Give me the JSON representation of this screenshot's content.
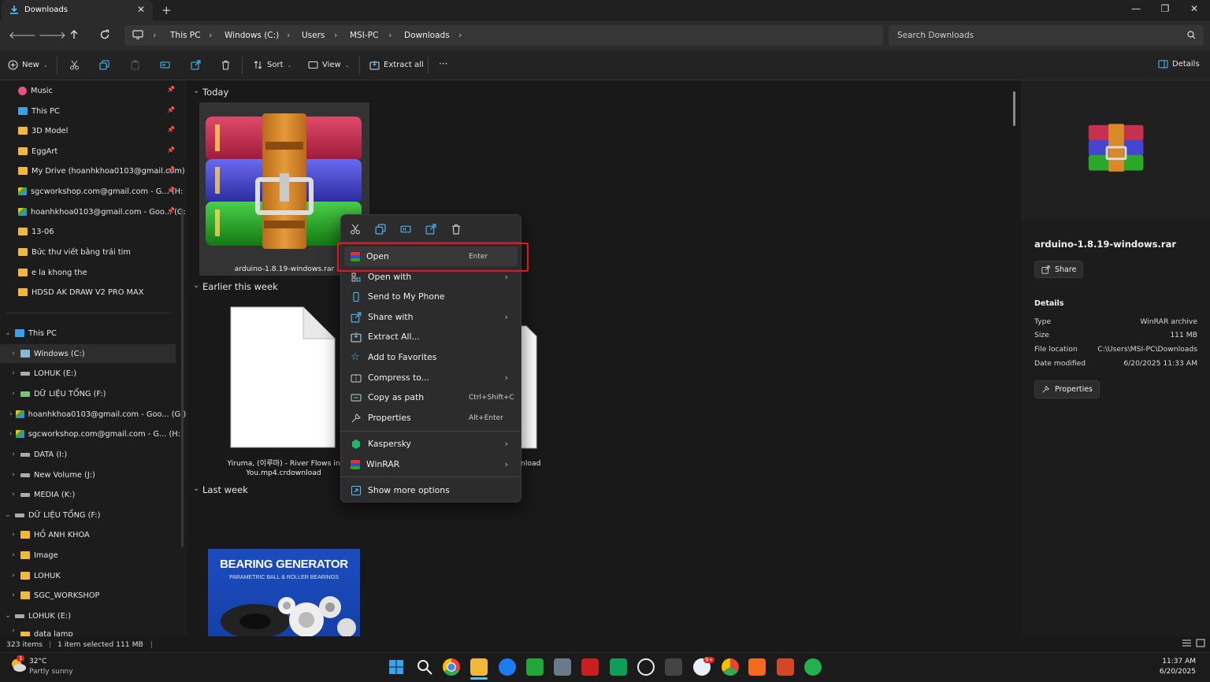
{
  "window": {
    "tab_title": "Downloads",
    "new_tab": "+",
    "close_tab": "✕",
    "minimize": "—",
    "restore": "❐",
    "close": "✕"
  },
  "address": {
    "crumbs": [
      "This PC",
      "Windows (C:)",
      "Users",
      "MSI-PC",
      "Downloads"
    ],
    "search_placeholder": "Search Downloads"
  },
  "commandbar": {
    "new": "New",
    "sort": "Sort",
    "view": "View",
    "extract_all": "Extract all",
    "more": "···",
    "details": "Details"
  },
  "nav": {
    "quick": [
      {
        "label": "Music",
        "icon": "music-icon"
      },
      {
        "label": "This PC",
        "icon": "pc-icon"
      },
      {
        "label": "3D Model",
        "icon": "folder-icon"
      },
      {
        "label": "EggArt",
        "icon": "folder-icon"
      },
      {
        "label": "My Drive (hoanhkhoa0103@gmail.com)",
        "icon": "folder-icon"
      },
      {
        "label": "sgcworkshop.com@gmail.com - G... (H:",
        "icon": "drive-icon"
      },
      {
        "label": "hoanhkhoa0103@gmail.com - Goo... (G:",
        "icon": "drive-icon"
      },
      {
        "label": "13-06",
        "icon": "folder-icon"
      },
      {
        "label": "Bức thư viết bằng trái tim",
        "icon": "folder-icon"
      },
      {
        "label": "e la khong the",
        "icon": "folder-icon"
      },
      {
        "label": "HDSD AK DRAW V2 PRO MAX",
        "icon": "folder-icon"
      }
    ],
    "this_pc": "This PC",
    "drives": [
      {
        "label": "Windows (C:)",
        "icon": "windows-drive-icon"
      },
      {
        "label": "LOHUK (E:)",
        "icon": "drive-icon"
      },
      {
        "label": "DỮ LIỆU TỔNG (F:)",
        "icon": "net-drive-icon"
      },
      {
        "label": "hoanhkhoa0103@gmail.com - Goo... (G:)",
        "icon": "gdrive-icon"
      },
      {
        "label": "sgcworkshop.com@gmail.com - G... (H:)",
        "icon": "gdrive-icon"
      },
      {
        "label": "DATA (I:)",
        "icon": "drive-icon"
      },
      {
        "label": "New Volume (J:)",
        "icon": "drive-icon"
      },
      {
        "label": "MEDIA (K:)",
        "icon": "drive-icon"
      }
    ],
    "f_drive": "DỮ LIỆU TỔNG (F:)",
    "f_children": [
      "HỒ ANH KHOA",
      "Image",
      "LOHUK",
      "SGC_WORKSHOP"
    ],
    "e_drive": "LOHUK (E:)",
    "e_child": "data lamp"
  },
  "content": {
    "groups": {
      "today": "Today",
      "earlier": "Earlier this week",
      "last_week": "Last week"
    },
    "file1": "arduino-1.8.19-windows.rar",
    "file2_line1": "Yiruma, (이루마) - River Flows in",
    "file2_line2": "You.mp4.crdownload",
    "file3_partial": "nload",
    "bearing_title": "BEARING GENERATOR",
    "bearing_sub": "PARAMETRIC BALL & ROLLER BEARINGS"
  },
  "context_menu": {
    "items": [
      {
        "label": "Open",
        "shortcut": "Enter",
        "icon": "winrar-icon",
        "submenu": false
      },
      {
        "label": "Open with",
        "shortcut": "",
        "icon": "open-with-icon",
        "submenu": true
      },
      {
        "label": "Send to My Phone",
        "shortcut": "",
        "icon": "phone-icon",
        "submenu": false
      },
      {
        "label": "Share with",
        "shortcut": "",
        "icon": "share-icon",
        "submenu": true
      },
      {
        "label": "Extract All...",
        "shortcut": "",
        "icon": "extract-icon",
        "submenu": false
      },
      {
        "label": "Add to Favorites",
        "shortcut": "",
        "icon": "star-icon",
        "submenu": false
      },
      {
        "label": "Compress to...",
        "shortcut": "",
        "icon": "compress-icon",
        "submenu": true
      },
      {
        "label": "Copy as path",
        "shortcut": "Ctrl+Shift+C",
        "icon": "copy-path-icon",
        "submenu": false
      },
      {
        "label": "Properties",
        "shortcut": "Alt+Enter",
        "icon": "wrench-icon",
        "submenu": false
      },
      {
        "label": "Kaspersky",
        "shortcut": "",
        "icon": "kaspersky-icon",
        "submenu": true
      },
      {
        "label": "WinRAR",
        "shortcut": "",
        "icon": "winrar-icon",
        "submenu": true
      },
      {
        "label": "Show more options",
        "shortcut": "",
        "icon": "more-options-icon",
        "submenu": false
      }
    ]
  },
  "details": {
    "filename": "arduino-1.8.19-windows.rar",
    "share": "Share",
    "heading": "Details",
    "rows": [
      {
        "label": "Type",
        "value": "WinRAR archive"
      },
      {
        "label": "Size",
        "value": "111 MB"
      },
      {
        "label": "File location",
        "value": "C:\\Users\\MSI-PC\\Downloads"
      },
      {
        "label": "Date modified",
        "value": "6/20/2025 11:33 AM"
      }
    ],
    "properties": "Properties"
  },
  "status": {
    "items": "323 items",
    "selected": "1 item selected  111 MB"
  },
  "taskbar": {
    "weather_temp": "32°C",
    "weather_desc": "Partly sunny",
    "time": "11:37 AM",
    "date": "6/20/2025",
    "mail_badge": "9+",
    "weather_badge": "1"
  },
  "colors": {
    "accent": "#0a84ff",
    "highlight_box": "#e8141e",
    "folder": "#f2b83a"
  }
}
